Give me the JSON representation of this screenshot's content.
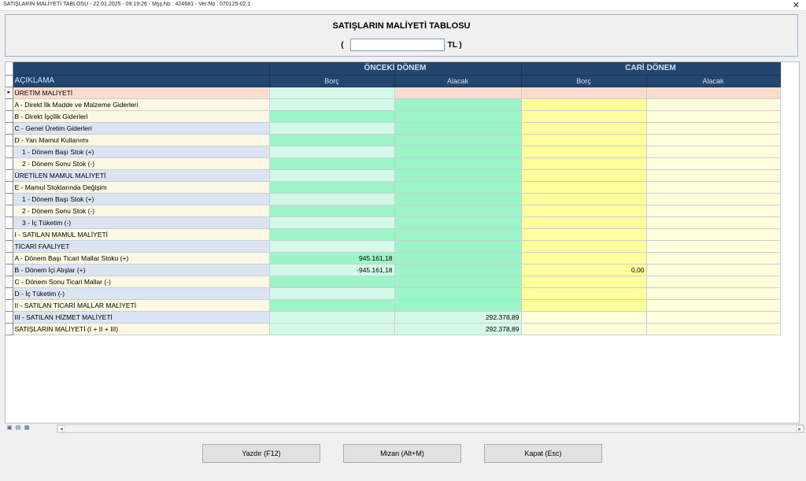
{
  "window": {
    "title": "SATIŞLARIN MALİYETİ TABLOSU - 22.01.2025 - 09:19:26 - Mşş.No : 424681 - Ver.No : 070125-02.1",
    "close_glyph": "✕"
  },
  "header": {
    "title": "SATIŞLARIN MALİYETİ TABLOSU",
    "open_paren": "(",
    "currency_value": "",
    "currency_suffix": "TL )"
  },
  "grid": {
    "col_header": "AÇIKLAMA",
    "group_prev": "ÖNCEKİ DÖNEM",
    "group_curr": "CARİ DÖNEM",
    "sub_debit": "Borç",
    "sub_credit": "Alacak",
    "current_row_marker": "▸",
    "colors": {
      "header_bg": "#23466e",
      "header_text": "#cfe0f4",
      "row_peach": "#f9dccd",
      "row_beige": "#fdf8e3",
      "row_blue": "#dbe4f2",
      "green_strong": "#9cf5c6",
      "green_light": "#d4f9e8",
      "yellow_strong": "#ffff9c",
      "yellow_light": "#ffffdb"
    },
    "rows": [
      {
        "label": "ÜRETİM MALİYETİ",
        "prev_debit": "",
        "prev_credit": "",
        "curr_debit": "",
        "curr_credit": "",
        "style": "peach"
      },
      {
        "label": "A - Direkt İlk Madde ve Malzeme Giderleri",
        "prev_debit": "",
        "prev_credit": "",
        "curr_debit": "",
        "curr_credit": "",
        "style": "beige"
      },
      {
        "label": "B - Direkt İşçilik Giderleri",
        "prev_debit": "",
        "prev_credit": "",
        "curr_debit": "",
        "curr_credit": "",
        "style": "beige"
      },
      {
        "label": "C - Genel Üretim Giderleri",
        "prev_debit": "",
        "prev_credit": "",
        "curr_debit": "",
        "curr_credit": "",
        "style": "blue"
      },
      {
        "label": "D - Yarı Mamul Kullanımı",
        "prev_debit": "",
        "prev_credit": "",
        "curr_debit": "",
        "curr_credit": "",
        "style": "beige"
      },
      {
        "label": "    1 - Dönem Başı Stok (+)",
        "prev_debit": "",
        "prev_credit": "",
        "curr_debit": "",
        "curr_credit": "",
        "style": "blue"
      },
      {
        "label": "    2 - Dönem Sonu Stok (-)",
        "prev_debit": "",
        "prev_credit": "",
        "curr_debit": "",
        "curr_credit": "",
        "style": "beige"
      },
      {
        "label": "ÜRETİLEN MAMUL MALİYETİ",
        "prev_debit": "",
        "prev_credit": "",
        "curr_debit": "",
        "curr_credit": "",
        "style": "blue"
      },
      {
        "label": "E - Mamul Stoklarında Değişim",
        "prev_debit": "",
        "prev_credit": "",
        "curr_debit": "",
        "curr_credit": "",
        "style": "beige"
      },
      {
        "label": "    1 - Dönem Başı Stok (+)",
        "prev_debit": "",
        "prev_credit": "",
        "curr_debit": "",
        "curr_credit": "",
        "style": "blue"
      },
      {
        "label": "    2 - Dönem Sonu Stok (-)",
        "prev_debit": "",
        "prev_credit": "",
        "curr_debit": "",
        "curr_credit": "",
        "style": "beige"
      },
      {
        "label": "    3 - İç Tüketim (-)",
        "prev_debit": "",
        "prev_credit": "",
        "curr_debit": "",
        "curr_credit": "",
        "style": "blue"
      },
      {
        "label": "I - SATILAN MAMUL MALİYETİ",
        "prev_debit": "",
        "prev_credit": "",
        "curr_debit": "",
        "curr_credit": "",
        "style": "beige"
      },
      {
        "label": "TİCARİ FAALİYET",
        "prev_debit": "",
        "prev_credit": "",
        "curr_debit": "",
        "curr_credit": "",
        "style": "blue"
      },
      {
        "label": "A - Dönem Başı Ticari Mallar Stoku (+)",
        "prev_debit": "945.161,18",
        "prev_credit": "",
        "curr_debit": "",
        "curr_credit": "",
        "style": "beige"
      },
      {
        "label": "B - Dönem İçi Alışlar (+)",
        "prev_debit": "-945.161,18",
        "prev_credit": "",
        "curr_debit": "0,00",
        "curr_credit": "",
        "style": "blue"
      },
      {
        "label": "C - Dönem Sonu Ticari Mallar (-)",
        "prev_debit": "",
        "prev_credit": "",
        "curr_debit": "",
        "curr_credit": "",
        "style": "beige"
      },
      {
        "label": "D - İç Tüketim (-)",
        "prev_debit": "",
        "prev_credit": "",
        "curr_debit": "",
        "curr_credit": "",
        "style": "blue"
      },
      {
        "label": "II - SATILAN TİCARİ MALLAR MALİYETİ",
        "prev_debit": "",
        "prev_credit": "",
        "curr_debit": "",
        "curr_credit": "",
        "style": "beige"
      },
      {
        "label": "III - SATILAN HİZMET MALİYETİ",
        "prev_debit": "",
        "prev_credit": "292.378,89",
        "curr_debit": "",
        "curr_credit": "",
        "style": "blue"
      },
      {
        "label": "SATIŞLARIN MALİYETİ (I + II + III)",
        "prev_debit": "",
        "prev_credit": "292.378,89",
        "curr_debit": "",
        "curr_credit": "",
        "style": "beige"
      }
    ]
  },
  "statusbar": {
    "icons": [
      "save-icon",
      "grid-icon",
      "print-icon"
    ],
    "icon_glyphs": [
      "▣",
      "▤",
      "▦"
    ],
    "scroll_left": "◂",
    "scroll_right": "▸"
  },
  "buttons": {
    "print": "Yazdır (F12)",
    "trial_balance": "Mizan (Alt+M)",
    "close": "Kapat (Esc)"
  }
}
